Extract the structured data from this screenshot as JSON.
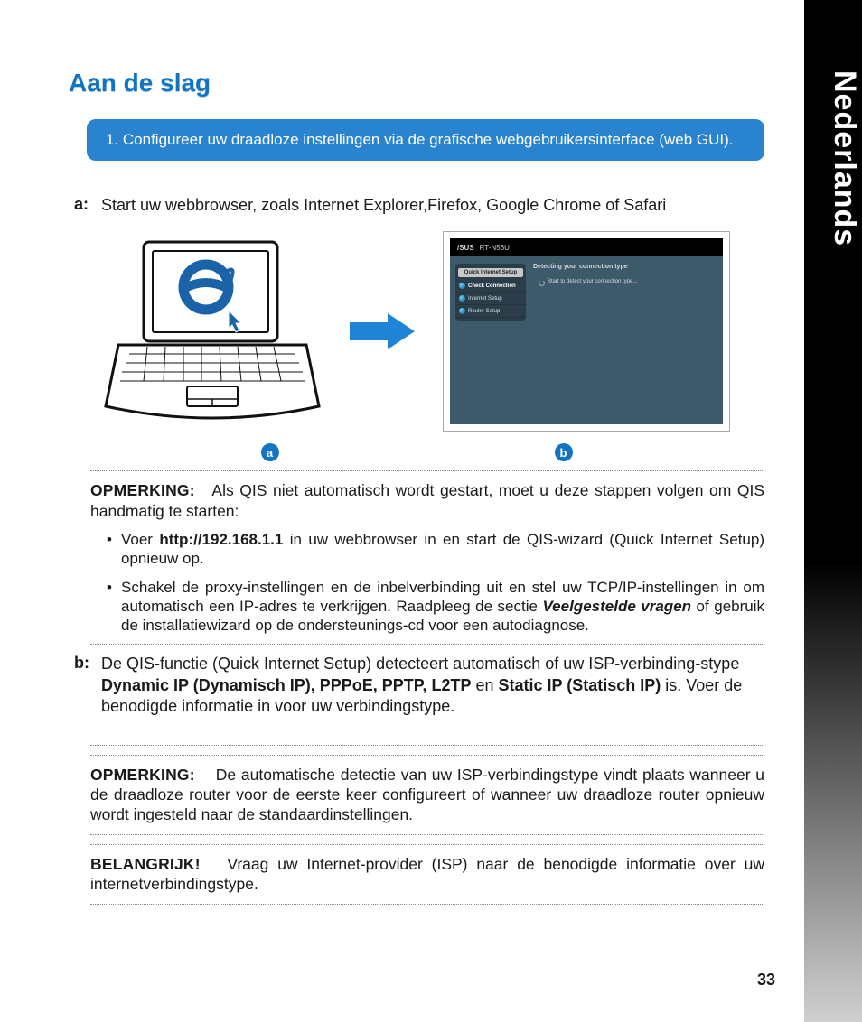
{
  "language_tab": "Nederlands",
  "page_number": "33",
  "heading": "Aan de slag",
  "blue_step": "1.   Configureer uw draadloze instellingen via de grafische webgebruikersinterface (web GUI).",
  "step_a": {
    "label": "a:",
    "text": "Start uw webbrowser, zoals Internet Explorer,Firefox, Google Chrome of Safari"
  },
  "badges": {
    "a": "a",
    "b": "b"
  },
  "router_ui": {
    "brand": "/SUS",
    "model": "RT-N56U",
    "sidebar_title": "Quick Internet Setup",
    "items": [
      "Check Connection",
      "Internet Setup",
      "Router Setup"
    ],
    "main_title": "Detecting your connection type",
    "main_line": "Start to detect your connection type..."
  },
  "note1": {
    "label": "OPMERKING:",
    "text": "Als QIS niet automatisch wordt gestart, moet u deze stappen volgen om QIS handmatig te starten:",
    "bullets": [
      {
        "pre": "Voer ",
        "bold": "http://192.168.1.1",
        "post": " in uw webbrowser in en start de QIS-wizard (Quick Internet Setup) opnieuw op."
      },
      {
        "pre": "Schakel de proxy-instellingen en de inbelverbinding uit en stel uw TCP/IP-instellingen in om automatisch een IP-adres te verkrijgen. Raadpleeg de sectie ",
        "em": "Veelgestelde vragen",
        "post": " of gebruik de installatiewizard op de ondersteunings-cd voor een autodiagnose."
      }
    ]
  },
  "step_b": {
    "label": "b:",
    "pre": "De QIS-functie (Quick Internet Setup) detecteert automatisch of uw ISP-verbinding-stype ",
    "bold1": "Dynamic IP (Dynamisch IP), PPPoE, PPTP, L2TP",
    "mid": " en ",
    "bold2": "Static IP (Statisch IP)",
    "post": " is. Voer de benodigde informatie in voor uw verbindingstype."
  },
  "note2": {
    "label": "OPMERKING:",
    "text": "De automatische detectie van uw ISP-verbindingstype vindt plaats wanneer u de draadloze router voor de eerste keer configureert of wanneer uw draadloze router opnieuw wordt ingesteld naar de standaardinstellingen."
  },
  "note3": {
    "label": "BELANGRIJK!",
    "text": "Vraag uw Internet-provider (ISP) naar de benodigde informatie over uw internetverbindingstype."
  }
}
